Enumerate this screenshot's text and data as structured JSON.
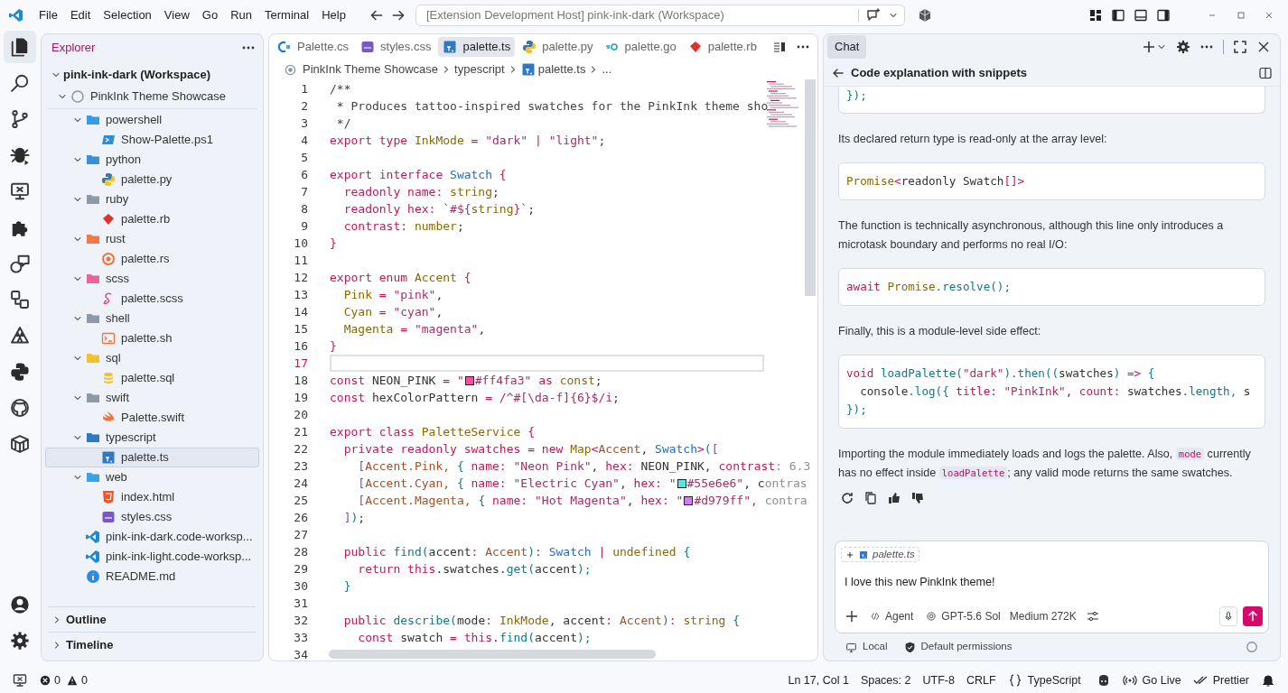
{
  "title_bar": {
    "menus": [
      "File",
      "Edit",
      "Selection",
      "View",
      "Go",
      "Run",
      "Terminal",
      "Help"
    ],
    "command_center": "[Extension Development Host] pink-ink-dark (Workspace)"
  },
  "activity_bar": [
    {
      "selected": true
    },
    {
      "selected": false
    },
    {
      "selected": false
    },
    {
      "selected": false
    },
    {
      "selected": false
    },
    {
      "selected": false
    },
    {
      "selected": false
    },
    {
      "selected": false
    },
    {
      "selected": false
    },
    {
      "selected": false
    },
    {
      "selected": false
    },
    {
      "selected": false
    }
  ],
  "explorer": {
    "title": "Explorer",
    "tree": [
      {
        "label": "pink-ink-dark (Workspace)",
        "kind": "folder",
        "expanded": true,
        "selected": false,
        "children": [
          {
            "label": "PinkInk Theme Showcase",
            "kind": "folder",
            "expanded": true,
            "selected": false,
            "children": [
              {
                "label": "powershell",
                "kind": "folder",
                "expanded": true,
                "selected": false,
                "children": [
                  {
                    "label": "Show-Palette.ps1",
                    "kind": "file",
                    "selected": false
                  }
                ]
              },
              {
                "label": "python",
                "kind": "folder",
                "expanded": true,
                "selected": false,
                "children": [
                  {
                    "label": "palette.py",
                    "kind": "file",
                    "selected": false
                  }
                ]
              },
              {
                "label": "ruby",
                "kind": "folder",
                "expanded": true,
                "selected": false,
                "children": [
                  {
                    "label": "palette.rb",
                    "kind": "file",
                    "selected": false
                  }
                ]
              },
              {
                "label": "rust",
                "kind": "folder",
                "expanded": true,
                "selected": false,
                "children": [
                  {
                    "label": "palette.rs",
                    "kind": "file",
                    "selected": false
                  }
                ]
              },
              {
                "label": "scss",
                "kind": "folder",
                "expanded": true,
                "selected": false,
                "children": [
                  {
                    "label": "palette.scss",
                    "kind": "file",
                    "selected": false
                  }
                ]
              },
              {
                "label": "shell",
                "kind": "folder",
                "expanded": true,
                "selected": false,
                "children": [
                  {
                    "label": "palette.sh",
                    "kind": "file",
                    "selected": false
                  }
                ]
              },
              {
                "label": "sql",
                "kind": "folder",
                "expanded": true,
                "selected": false,
                "children": [
                  {
                    "label": "palette.sql",
                    "kind": "file",
                    "selected": false
                  }
                ]
              },
              {
                "label": "swift",
                "kind": "folder",
                "expanded": true,
                "selected": false,
                "children": [
                  {
                    "label": "Palette.swift",
                    "kind": "file",
                    "selected": false
                  }
                ]
              },
              {
                "label": "typescript",
                "kind": "folder",
                "expanded": true,
                "selected": false,
                "children": [
                  {
                    "label": "palette.ts",
                    "kind": "file",
                    "selected": true
                  }
                ]
              },
              {
                "label": "web",
                "kind": "folder",
                "expanded": true,
                "selected": false,
                "children": [
                  {
                    "label": "index.html",
                    "kind": "file",
                    "selected": false
                  },
                  {
                    "label": "styles.css",
                    "kind": "file",
                    "selected": false
                  }
                ]
              },
              {
                "label": "pink-ink-dark.code-worksp...",
                "kind": "file",
                "selected": false
              },
              {
                "label": "pink-ink-light.code-worksp...",
                "kind": "file",
                "selected": false
              },
              {
                "label": "README.md",
                "kind": "file",
                "selected": false
              }
            ]
          }
        ]
      }
    ],
    "sections": [
      {
        "label": "Outline",
        "expanded": false
      },
      {
        "label": "Timeline",
        "expanded": false
      }
    ]
  },
  "editor": {
    "tabs": [
      {
        "label": "Palette.cs",
        "selected": false
      },
      {
        "label": "styles.css",
        "selected": false
      },
      {
        "label": "palette.ts",
        "selected": true
      },
      {
        "label": "palette.py",
        "selected": false
      },
      {
        "label": "palette.go",
        "selected": false
      },
      {
        "label": "palette.rb",
        "selected": false
      }
    ],
    "breadcrumbs": [
      "PinkInk Theme Showcase",
      "typescript",
      "palette.ts",
      "..."
    ],
    "lines": [
      {
        "number": "1",
        "current": false,
        "tokens": [
          {
            "text": "/**",
            "kind": "com"
          }
        ]
      },
      {
        "number": "2",
        "current": false,
        "tokens": [
          {
            "text": " * Produces tattoo-inspired swatches for the PinkInk theme sho",
            "kind": "com"
          }
        ]
      },
      {
        "number": "3",
        "current": false,
        "tokens": [
          {
            "text": " */",
            "kind": "com"
          }
        ]
      },
      {
        "number": "4",
        "current": false,
        "tokens": [
          {
            "text": "export type ",
            "kind": "kw"
          },
          {
            "text": "InkMode",
            "kind": "type"
          },
          {
            "text": " = ",
            "kind": "kw"
          },
          {
            "text": "\"dark\"",
            "kind": "str"
          },
          {
            "text": " | ",
            "kind": "kw"
          },
          {
            "text": "\"light\"",
            "kind": "str"
          },
          {
            "text": ";",
            "kind": "plain"
          }
        ]
      },
      {
        "number": "5",
        "current": false
      },
      {
        "number": "6",
        "current": false,
        "tokens": [
          {
            "text": "export interface ",
            "kind": "kw"
          },
          {
            "text": "Swatch",
            "kind": "cls"
          },
          {
            "text": " {",
            "kind": "b1"
          }
        ]
      },
      {
        "number": "7",
        "current": false,
        "tokens": [
          {
            "text": "  readonly name",
            "kind": "kw"
          },
          {
            "text": ": ",
            "kind": "kw"
          },
          {
            "text": "string",
            "kind": "type"
          },
          {
            "text": ";",
            "kind": "plain"
          }
        ]
      },
      {
        "number": "8",
        "current": false,
        "tokens": [
          {
            "text": "  readonly hex",
            "kind": "kw"
          },
          {
            "text": ": ",
            "kind": "kw"
          },
          {
            "text": "`#${",
            "kind": "str"
          },
          {
            "text": "string",
            "kind": "type"
          },
          {
            "text": "}`",
            "kind": "str"
          },
          {
            "text": ";",
            "kind": "plain"
          }
        ]
      },
      {
        "number": "9",
        "current": false,
        "tokens": [
          {
            "text": "  contrast",
            "kind": "kw"
          },
          {
            "text": ": ",
            "kind": "kw"
          },
          {
            "text": "number",
            "kind": "type"
          },
          {
            "text": ";",
            "kind": "plain"
          }
        ]
      },
      {
        "number": "10",
        "current": false,
        "tokens": [
          {
            "text": "}",
            "kind": "b1"
          }
        ]
      },
      {
        "number": "11",
        "current": false
      },
      {
        "number": "12",
        "current": false,
        "tokens": [
          {
            "text": "export enum ",
            "kind": "kw"
          },
          {
            "text": "Accent",
            "kind": "type"
          },
          {
            "text": " {",
            "kind": "b1"
          }
        ]
      },
      {
        "number": "13",
        "current": false,
        "tokens": [
          {
            "text": "  Pink",
            "kind": "type"
          },
          {
            "text": " = ",
            "kind": "kw"
          },
          {
            "text": "\"pink\"",
            "kind": "str"
          },
          {
            "text": ",",
            "kind": "plain"
          }
        ]
      },
      {
        "number": "14",
        "current": false,
        "tokens": [
          {
            "text": "  Cyan",
            "kind": "type"
          },
          {
            "text": " = ",
            "kind": "kw"
          },
          {
            "text": "\"cyan\"",
            "kind": "str"
          },
          {
            "text": ",",
            "kind": "plain"
          }
        ]
      },
      {
        "number": "15",
        "current": false,
        "tokens": [
          {
            "text": "  Magenta",
            "kind": "type"
          },
          {
            "text": " = ",
            "kind": "kw"
          },
          {
            "text": "\"magenta\"",
            "kind": "str"
          },
          {
            "text": ",",
            "kind": "plain"
          }
        ]
      },
      {
        "number": "16",
        "current": false,
        "tokens": [
          {
            "text": "}",
            "kind": "b1"
          }
        ]
      },
      {
        "number": "17",
        "current": true
      },
      {
        "number": "18",
        "current": false,
        "tokens": [
          {
            "text": "const ",
            "kind": "kw"
          },
          {
            "text": "NEON_PINK",
            "kind": "plain"
          },
          {
            "text": " = ",
            "kind": "kw"
          },
          {
            "text": "\"",
            "kind": "str"
          },
          {
            "kind": "swatch",
            "color": "#ff4fa3"
          },
          {
            "text": "#ff4fa3\"",
            "kind": "str"
          },
          {
            "text": " as ",
            "kind": "kw"
          },
          {
            "text": "const",
            "kind": "type"
          },
          {
            "text": ";",
            "kind": "plain"
          }
        ]
      },
      {
        "number": "19",
        "current": false,
        "tokens": [
          {
            "text": "const ",
            "kind": "kw"
          },
          {
            "text": "hexColorPattern",
            "kind": "plain"
          },
          {
            "text": " = ",
            "kind": "kw"
          },
          {
            "text": "/^#[\\da-f]{6}$/i",
            "kind": "str"
          },
          {
            "text": ";",
            "kind": "plain"
          }
        ]
      },
      {
        "number": "20",
        "current": false
      },
      {
        "number": "21",
        "current": false,
        "tokens": [
          {
            "text": "export class ",
            "kind": "kw"
          },
          {
            "text": "PaletteService",
            "kind": "type"
          },
          {
            "text": " {",
            "kind": "b1"
          }
        ]
      },
      {
        "number": "22",
        "current": false,
        "tokens": [
          {
            "text": "  private readonly swatches",
            "kind": "kw"
          },
          {
            "text": " = ",
            "kind": "kw"
          },
          {
            "text": "new ",
            "kind": "kw"
          },
          {
            "text": "Map",
            "kind": "type"
          },
          {
            "text": "<",
            "kind": "kw"
          },
          {
            "text": "Accent",
            "kind": "acc"
          },
          {
            "text": ", ",
            "kind": "plain"
          },
          {
            "text": "Swatch",
            "kind": "cls"
          },
          {
            "text": ">",
            "kind": "kw"
          },
          {
            "text": "(",
            "kind": "b2"
          },
          {
            "text": "[",
            "kind": "b3"
          }
        ]
      },
      {
        "number": "23",
        "current": false,
        "tokens": [
          {
            "text": "    [",
            "kind": "b3"
          },
          {
            "text": "Accent.Pink, ",
            "kind": "acc"
          },
          {
            "text": "{",
            "kind": "b2"
          },
          {
            "text": " name: ",
            "kind": "kw"
          },
          {
            "text": "\"Neon Pink\"",
            "kind": "str"
          },
          {
            "text": ", ",
            "kind": "plain"
          },
          {
            "text": "hex: ",
            "kind": "kw"
          },
          {
            "text": "NEON_PINK",
            "kind": "plain"
          },
          {
            "text": ", ",
            "kind": "plain"
          },
          {
            "text": "contrast",
            "kind": "kw"
          },
          {
            "text": ": 6.3",
            "kind": "fade"
          }
        ]
      },
      {
        "number": "24",
        "current": false,
        "tokens": [
          {
            "text": "    [",
            "kind": "b3"
          },
          {
            "text": "Accent.Cyan, ",
            "kind": "acc"
          },
          {
            "text": "{",
            "kind": "b2"
          },
          {
            "text": " name: ",
            "kind": "kw"
          },
          {
            "text": "\"Electric Cyan\"",
            "kind": "str"
          },
          {
            "text": ", ",
            "kind": "plain"
          },
          {
            "text": "hex: ",
            "kind": "kw"
          },
          {
            "text": "\"",
            "kind": "str"
          },
          {
            "kind": "swatch",
            "color": "#55e6e6"
          },
          {
            "text": "#55e6e6\"",
            "kind": "str"
          },
          {
            "text": ", c",
            "kind": "plain"
          },
          {
            "text": "ontras",
            "kind": "fade"
          }
        ]
      },
      {
        "number": "25",
        "current": false,
        "tokens": [
          {
            "text": "    [",
            "kind": "b3"
          },
          {
            "text": "Accent.Magenta, ",
            "kind": "acc"
          },
          {
            "text": "{",
            "kind": "b2"
          },
          {
            "text": " name: ",
            "kind": "kw"
          },
          {
            "text": "\"Hot Magenta\"",
            "kind": "str"
          },
          {
            "text": ", ",
            "kind": "plain"
          },
          {
            "text": "hex: ",
            "kind": "kw"
          },
          {
            "text": "\"",
            "kind": "str"
          },
          {
            "kind": "swatch",
            "color": "#d979ff"
          },
          {
            "text": "#d979ff\", ",
            "kind": "str"
          },
          {
            "text": "contra",
            "kind": "fade"
          }
        ]
      },
      {
        "number": "26",
        "current": false,
        "tokens": [
          {
            "text": "  ]",
            "kind": "b3"
          },
          {
            "text": ")",
            "kind": "b2"
          },
          {
            "text": ";",
            "kind": "plain"
          }
        ]
      },
      {
        "number": "27",
        "current": false
      },
      {
        "number": "28",
        "current": false,
        "tokens": [
          {
            "text": "  public ",
            "kind": "kw"
          },
          {
            "text": "find",
            "kind": "fn"
          },
          {
            "text": "(",
            "kind": "b2"
          },
          {
            "text": "accent",
            "kind": "plain"
          },
          {
            "text": ": ",
            "kind": "kw"
          },
          {
            "text": "Accent",
            "kind": "acc"
          },
          {
            "text": ")",
            "kind": "b2"
          },
          {
            "text": ": ",
            "kind": "kw"
          },
          {
            "text": "Swatch",
            "kind": "cls"
          },
          {
            "text": " | ",
            "kind": "kw"
          },
          {
            "text": "undefined",
            "kind": "type"
          },
          {
            "text": " {",
            "kind": "b2"
          }
        ]
      },
      {
        "number": "29",
        "current": false,
        "tokens": [
          {
            "text": "    return ",
            "kind": "kw"
          },
          {
            "text": "this",
            "kind": "kw"
          },
          {
            "text": ".swatches.",
            "kind": "plain"
          },
          {
            "text": "get",
            "kind": "fn"
          },
          {
            "text": "(",
            "kind": "b2"
          },
          {
            "text": "accent",
            "kind": "plain"
          },
          {
            "text": ");",
            "kind": "b2"
          }
        ]
      },
      {
        "number": "30",
        "current": false,
        "tokens": [
          {
            "text": "  }",
            "kind": "b2"
          }
        ]
      },
      {
        "number": "31",
        "current": false
      },
      {
        "number": "32",
        "current": false,
        "tokens": [
          {
            "text": "  public ",
            "kind": "kw"
          },
          {
            "text": "describe",
            "kind": "fn"
          },
          {
            "text": "(",
            "kind": "b2"
          },
          {
            "text": "mode",
            "kind": "plain"
          },
          {
            "text": ": ",
            "kind": "kw"
          },
          {
            "text": "InkMode",
            "kind": "type"
          },
          {
            "text": ", ",
            "kind": "plain"
          },
          {
            "text": "accent",
            "kind": "plain"
          },
          {
            "text": ": ",
            "kind": "kw"
          },
          {
            "text": "Accent",
            "kind": "acc"
          },
          {
            "text": ")",
            "kind": "b2"
          },
          {
            "text": ": ",
            "kind": "kw"
          },
          {
            "text": "string",
            "kind": "type"
          },
          {
            "text": " {",
            "kind": "b2"
          }
        ]
      },
      {
        "number": "33",
        "current": false,
        "tokens": [
          {
            "text": "    const ",
            "kind": "kw"
          },
          {
            "text": "swatch",
            "kind": "plain"
          },
          {
            "text": " = ",
            "kind": "kw"
          },
          {
            "text": "this",
            "kind": "kw"
          },
          {
            "text": ".",
            "kind": "plain"
          },
          {
            "text": "find",
            "kind": "fn"
          },
          {
            "text": "(",
            "kind": "b2"
          },
          {
            "text": "accent",
            "kind": "plain"
          },
          {
            "text": ");",
            "kind": "b2"
          }
        ]
      },
      {
        "number": "34",
        "current": false
      }
    ]
  },
  "chat": {
    "tab": "Chat",
    "title": "Code explanation with snippets",
    "blocks": [
      {
        "kind": "code",
        "cut": true,
        "lines": [
          [
            {
              "text": "});",
              "kind": "b2"
            }
          ]
        ]
      },
      {
        "kind": "text",
        "segments": [
          {
            "kind": "text",
            "text": "Its declared return type is read-only at the array level:"
          }
        ]
      },
      {
        "kind": "code",
        "cut": false,
        "lines": [
          [
            {
              "text": "Promise",
              "kind": "type"
            },
            {
              "text": "<",
              "kind": "kw"
            },
            {
              "text": "readonly Swatch",
              "kind": "plain"
            },
            {
              "text": "[]>",
              "kind": "kw"
            }
          ]
        ]
      },
      {
        "kind": "text",
        "segments": [
          {
            "kind": "text",
            "text": "The function is technically asynchronous, although this line only introduces a microtask boundary and performs no real I/O:"
          }
        ]
      },
      {
        "kind": "code",
        "cut": false,
        "lines": [
          [
            {
              "text": "await ",
              "kind": "kw"
            },
            {
              "text": "Promise",
              "kind": "type"
            },
            {
              "text": ".",
              "kind": "fn"
            },
            {
              "text": "resolve",
              "kind": "fn"
            },
            {
              "text": "();",
              "kind": "b2"
            }
          ]
        ]
      },
      {
        "kind": "text",
        "segments": [
          {
            "kind": "text",
            "text": "Finally, this is a module-level side effect:"
          }
        ]
      },
      {
        "kind": "code",
        "cut": false,
        "lines": [
          [
            {
              "text": "void ",
              "kind": "kw"
            },
            {
              "text": "loadPalette",
              "kind": "fn"
            },
            {
              "text": "(",
              "kind": "b2"
            },
            {
              "text": "\"dark\"",
              "kind": "str"
            },
            {
              "text": ").",
              "kind": "b2"
            },
            {
              "text": "then",
              "kind": "fn"
            },
            {
              "text": "((",
              "kind": "b2"
            },
            {
              "text": "swatches",
              "kind": "plain"
            },
            {
              "text": ")",
              "kind": "b2"
            },
            {
              "text": " => ",
              "kind": "kw"
            },
            {
              "text": "{",
              "kind": "b2"
            }
          ],
          [
            {
              "text": "  console",
              "kind": "plain"
            },
            {
              "text": ".",
              "kind": "fn"
            },
            {
              "text": "log",
              "kind": "fn"
            },
            {
              "text": "({",
              "kind": "b2"
            },
            {
              "text": " title: ",
              "kind": "kw"
            },
            {
              "text": "\"PinkInk\"",
              "kind": "str"
            },
            {
              "text": ", ",
              "kind": "plain"
            },
            {
              "text": "count: ",
              "kind": "kw"
            },
            {
              "text": "swatches",
              "kind": "plain"
            },
            {
              "text": ".length, ",
              "kind": "fn"
            },
            {
              "text": "s",
              "kind": "plain"
            }
          ],
          [
            {
              "text": "});",
              "kind": "b2"
            }
          ]
        ]
      },
      {
        "kind": "text",
        "segments": [
          {
            "kind": "text",
            "text": "Importing the module immediately loads and logs the palette. Also, "
          },
          {
            "kind": "code",
            "text": "mode"
          },
          {
            "kind": "text",
            "text": " currently has no effect inside "
          },
          {
            "kind": "code",
            "text": "loadPalette"
          },
          {
            "kind": "text",
            "text": "; any valid mode returns the same swatches."
          }
        ]
      }
    ],
    "input": {
      "attachment": "palette.ts",
      "value": "I love this new PinkInk theme!",
      "mode": "Agent",
      "model": "GPT-5.6 Sol",
      "effort": "Medium 272K"
    },
    "footer": [
      "Local",
      "Default permissions"
    ]
  },
  "status_bar": {
    "errors": "0",
    "warnings": "0",
    "items": [
      "Ln 17, Col 1",
      "Spaces: 2",
      "UTF-8",
      "CRLF",
      "TypeScript",
      "Go Live",
      "Prettier"
    ]
  }
}
